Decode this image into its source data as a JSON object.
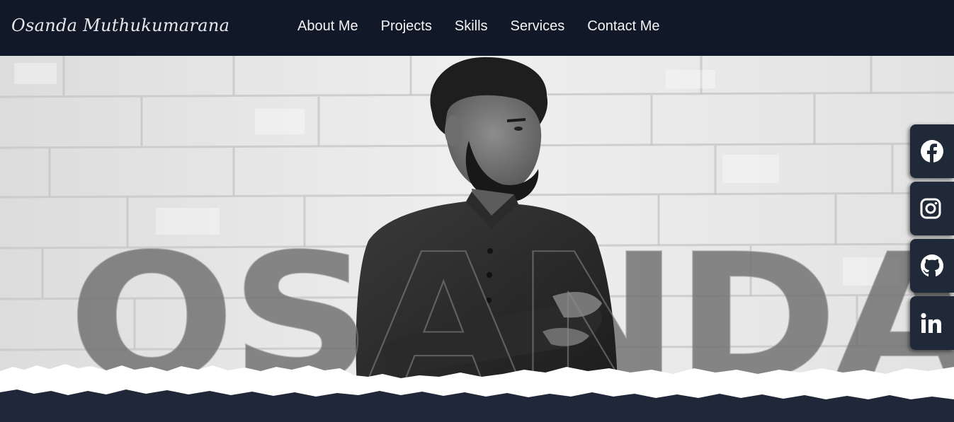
{
  "brand": {
    "logo_text": "Osanda Muthukumarana"
  },
  "nav": {
    "items": [
      {
        "label": "About Me"
      },
      {
        "label": "Projects"
      },
      {
        "label": "Skills"
      },
      {
        "label": "Services"
      },
      {
        "label": "Contact Me"
      }
    ]
  },
  "hero": {
    "big_name": "OSANDA"
  },
  "social": [
    {
      "icon": "facebook-icon"
    },
    {
      "icon": "instagram-icon"
    },
    {
      "icon": "github-icon"
    },
    {
      "icon": "linkedin-icon"
    }
  ],
  "colors": {
    "navbar_bg": "#111827",
    "page_bg": "#1f2738",
    "social_bg": "#1f2937",
    "text": "#f3f4f6"
  }
}
